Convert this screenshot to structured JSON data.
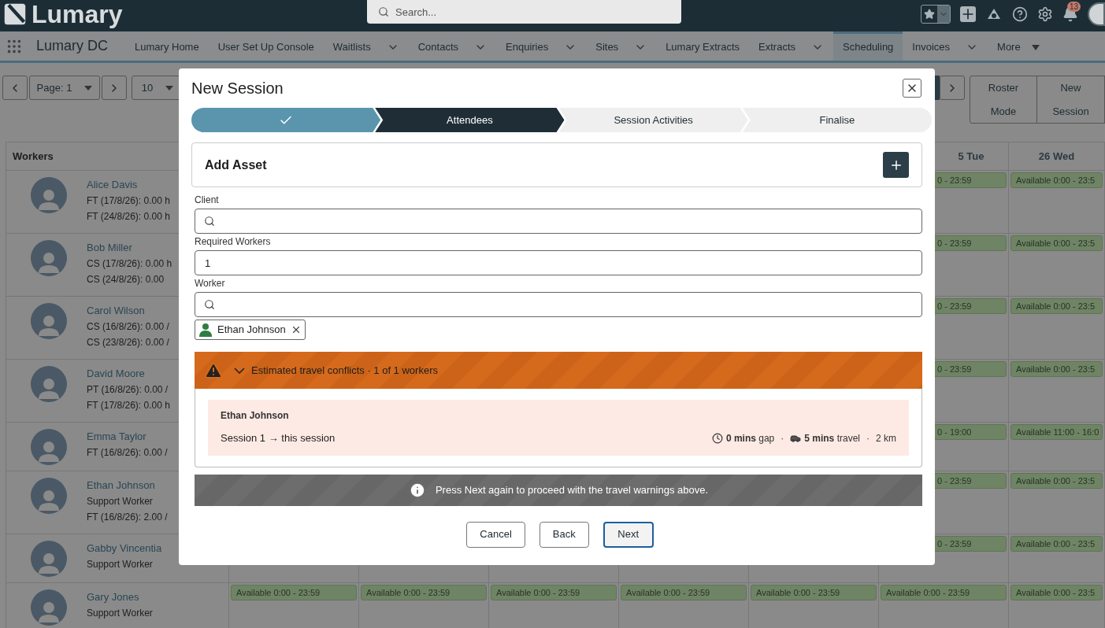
{
  "header": {
    "logo": "Lumary",
    "search": {
      "placeholder": "Search..."
    },
    "notifications": "13"
  },
  "nav": {
    "app_name": "Lumary DC",
    "items": [
      {
        "label": "Lumary Home",
        "selected": false,
        "kind": "link"
      },
      {
        "label": "User Set Up Console",
        "selected": false,
        "kind": "link"
      },
      {
        "label": "Waitlists",
        "selected": false,
        "kind": "dropdown"
      },
      {
        "label": "Contacts",
        "selected": false,
        "kind": "dropdown"
      },
      {
        "label": "Enquiries",
        "selected": false,
        "kind": "dropdown"
      },
      {
        "label": "Sites",
        "selected": false,
        "kind": "dropdown"
      },
      {
        "label": "Lumary Extracts",
        "selected": false,
        "kind": "link"
      },
      {
        "label": "Extracts",
        "selected": false,
        "kind": "dropdown"
      },
      {
        "label": "Scheduling",
        "selected": true,
        "kind": "link"
      },
      {
        "label": "Invoices",
        "selected": false,
        "kind": "dropdown"
      },
      {
        "label": "More",
        "selected": false,
        "kind": "overflow"
      }
    ]
  },
  "toolbar": {
    "page_select": "Page: 1",
    "page_size": "10",
    "buttons": [
      "Roster Mode",
      "New Session"
    ]
  },
  "schedule": {
    "workers_heading": "Workers",
    "day_headings": [
      "5 Tue",
      "26 Wed"
    ],
    "workers": [
      {
        "name": "Alice Davis",
        "lines": [
          "FT (17/8/26): 0.00 h",
          "FT (24/8/26): 0.00 h"
        ],
        "cells": [
          {
            "kind": "partial",
            "text": "0 - 23:59"
          },
          {
            "kind": "full",
            "text": "Available 0:00 - 23:5"
          }
        ]
      },
      {
        "name": "Bob Miller",
        "lines": [
          "CS (17/8/26): 0.00 h",
          "CS (24/8/26): 0.00"
        ],
        "cells": [
          {
            "kind": "partial",
            "text": "0 - 23:59"
          },
          {
            "kind": "full",
            "text": "Available 0:00 - 23:5"
          }
        ]
      },
      {
        "name": "Carol Wilson",
        "lines": [
          "CS (16/8/26): 0.00 /",
          "CS (23/8/26): 0.00 /"
        ],
        "cells": [
          {
            "kind": "partial",
            "text": "0 - 23:59"
          },
          {
            "kind": "full",
            "text": "Available 0:00 - 23:5"
          }
        ]
      },
      {
        "name": "David Moore",
        "lines": [
          "PT (16/8/26): 0.00 /",
          "FT (17/8/26): 0.00 h"
        ],
        "cells": [
          {
            "kind": "partial",
            "text": "0 - 23:59"
          },
          {
            "kind": "full",
            "text": "Available 0:00 - 23:5"
          }
        ]
      },
      {
        "name": "Emma Taylor",
        "lines": [
          "FT (16/8/26): 0.00 /"
        ],
        "cells": [
          {
            "kind": "partial",
            "text": "0 - 19:00"
          },
          {
            "kind": "full",
            "text": "Available 11:00 - 16:0"
          }
        ]
      },
      {
        "name": "Ethan Johnson",
        "lines": [
          "Support Worker",
          "FT (16/8/26): 2.00 /"
        ],
        "cells": [
          {
            "kind": "partial",
            "text": "0 - 23:59"
          },
          {
            "kind": "full",
            "text": "Available 0:00 - 23:5"
          }
        ]
      },
      {
        "name": "Gabby Vincentia",
        "lines": [
          "Support Worker"
        ],
        "cells": [
          {
            "kind": "partial",
            "text": "0 - 23:59"
          },
          {
            "kind": "full",
            "text": "Available 0:00 - 23:5"
          }
        ]
      },
      {
        "name": "Gary Jones",
        "lines": [
          "Support Worker"
        ],
        "cells": [
          {
            "kind": "full",
            "text": "Available 0:00 - 23:59"
          },
          {
            "kind": "full",
            "text": "Available 0:00 - 23:59"
          },
          {
            "kind": "full",
            "text": "Available 0:00 - 23:59"
          },
          {
            "kind": "full",
            "text": "Available 0:00 - 23:59"
          },
          {
            "kind": "full",
            "text": "Available 0:00 - 23:59"
          },
          {
            "kind": "full",
            "text": "Available 0:00 - 23:59"
          },
          {
            "kind": "full",
            "text": "Available 0:00 - 23:5"
          }
        ]
      }
    ]
  },
  "modal": {
    "title": "New Session",
    "steps": [
      {
        "completed": true,
        "selected": false
      },
      {
        "label": "Attendees",
        "completed": false,
        "selected": true
      },
      {
        "label": "Session Activities",
        "completed": false,
        "selected": false
      },
      {
        "label": "Finalise",
        "completed": false,
        "selected": false
      }
    ],
    "asset_card": {
      "title": "Add Asset"
    },
    "fields": [
      {
        "label": "Client",
        "kind": "search"
      },
      {
        "label": "Required Workers",
        "kind": "text",
        "value": "1"
      },
      {
        "label": "Worker",
        "kind": "search"
      }
    ],
    "selected_workers": [
      "Ethan Johnson"
    ],
    "conflicts": {
      "title": "Estimated travel conflicts · 1 of 1 workers",
      "expanded": true,
      "items": [
        {
          "name": "Ethan Johnson",
          "route": "Session 1 → this session",
          "metrics": [
            {
              "kind": "clock",
              "text": "**0 mins** gap"
            },
            {
              "kind": "separator",
              "text": "·"
            },
            {
              "kind": "car",
              "text": "**5 mins** travel"
            },
            {
              "kind": "separator",
              "text": "·"
            },
            {
              "kind": "plain",
              "text": "2 km"
            }
          ]
        }
      ]
    },
    "notice": "Press Next again to proceed with the travel warnings above.",
    "buttons": [
      {
        "label": "Cancel",
        "focused": false
      },
      {
        "label": "Back",
        "focused": false
      },
      {
        "label": "Next",
        "focused": true
      }
    ]
  }
}
